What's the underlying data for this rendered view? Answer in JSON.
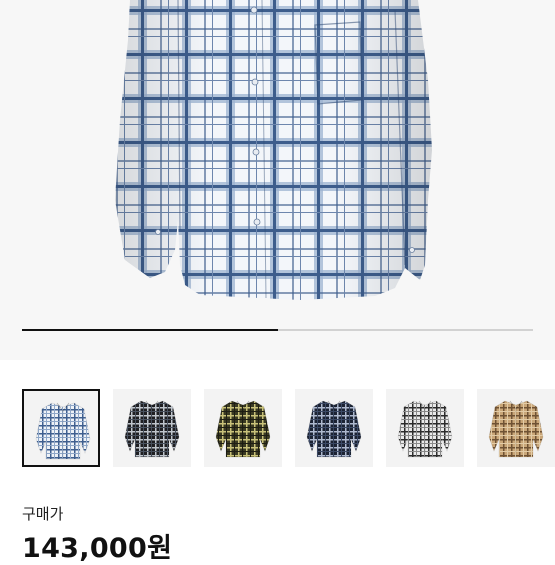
{
  "gallery": {
    "current_image": 1,
    "image_count": 6,
    "progress_fraction": 0.5,
    "thumbnails": [
      {
        "name": "thumb-blue-plaid",
        "base": "#eef2f7",
        "stripe": "#3f5f8f",
        "accent": "#8fa7c8"
      },
      {
        "name": "thumb-black-plaid",
        "base": "#1f1f22",
        "stripe": "#bfc5cc",
        "accent": "#4a5360"
      },
      {
        "name": "thumb-olive-plaid",
        "base": "#3a3a22",
        "stripe": "#c9c27a",
        "accent": "#1e1e14"
      },
      {
        "name": "thumb-navy-plaid",
        "base": "#1c2333",
        "stripe": "#aeb9cf",
        "accent": "#3c4a66"
      },
      {
        "name": "thumb-grey-plaid",
        "base": "#e9e9e9",
        "stripe": "#2b2b2b",
        "accent": "#8a8a8a"
      },
      {
        "name": "thumb-beige-plaid",
        "base": "#c9a678",
        "stripe": "#6f5234",
        "accent": "#e2cba6"
      }
    ]
  },
  "product": {
    "price_label": "구매가",
    "price_value": "143,000원"
  },
  "colors": {
    "shirt_base": "#f3f6fa",
    "shirt_stripe_dark": "#3d5d8c",
    "shirt_stripe_light": "#9cb2d0"
  }
}
